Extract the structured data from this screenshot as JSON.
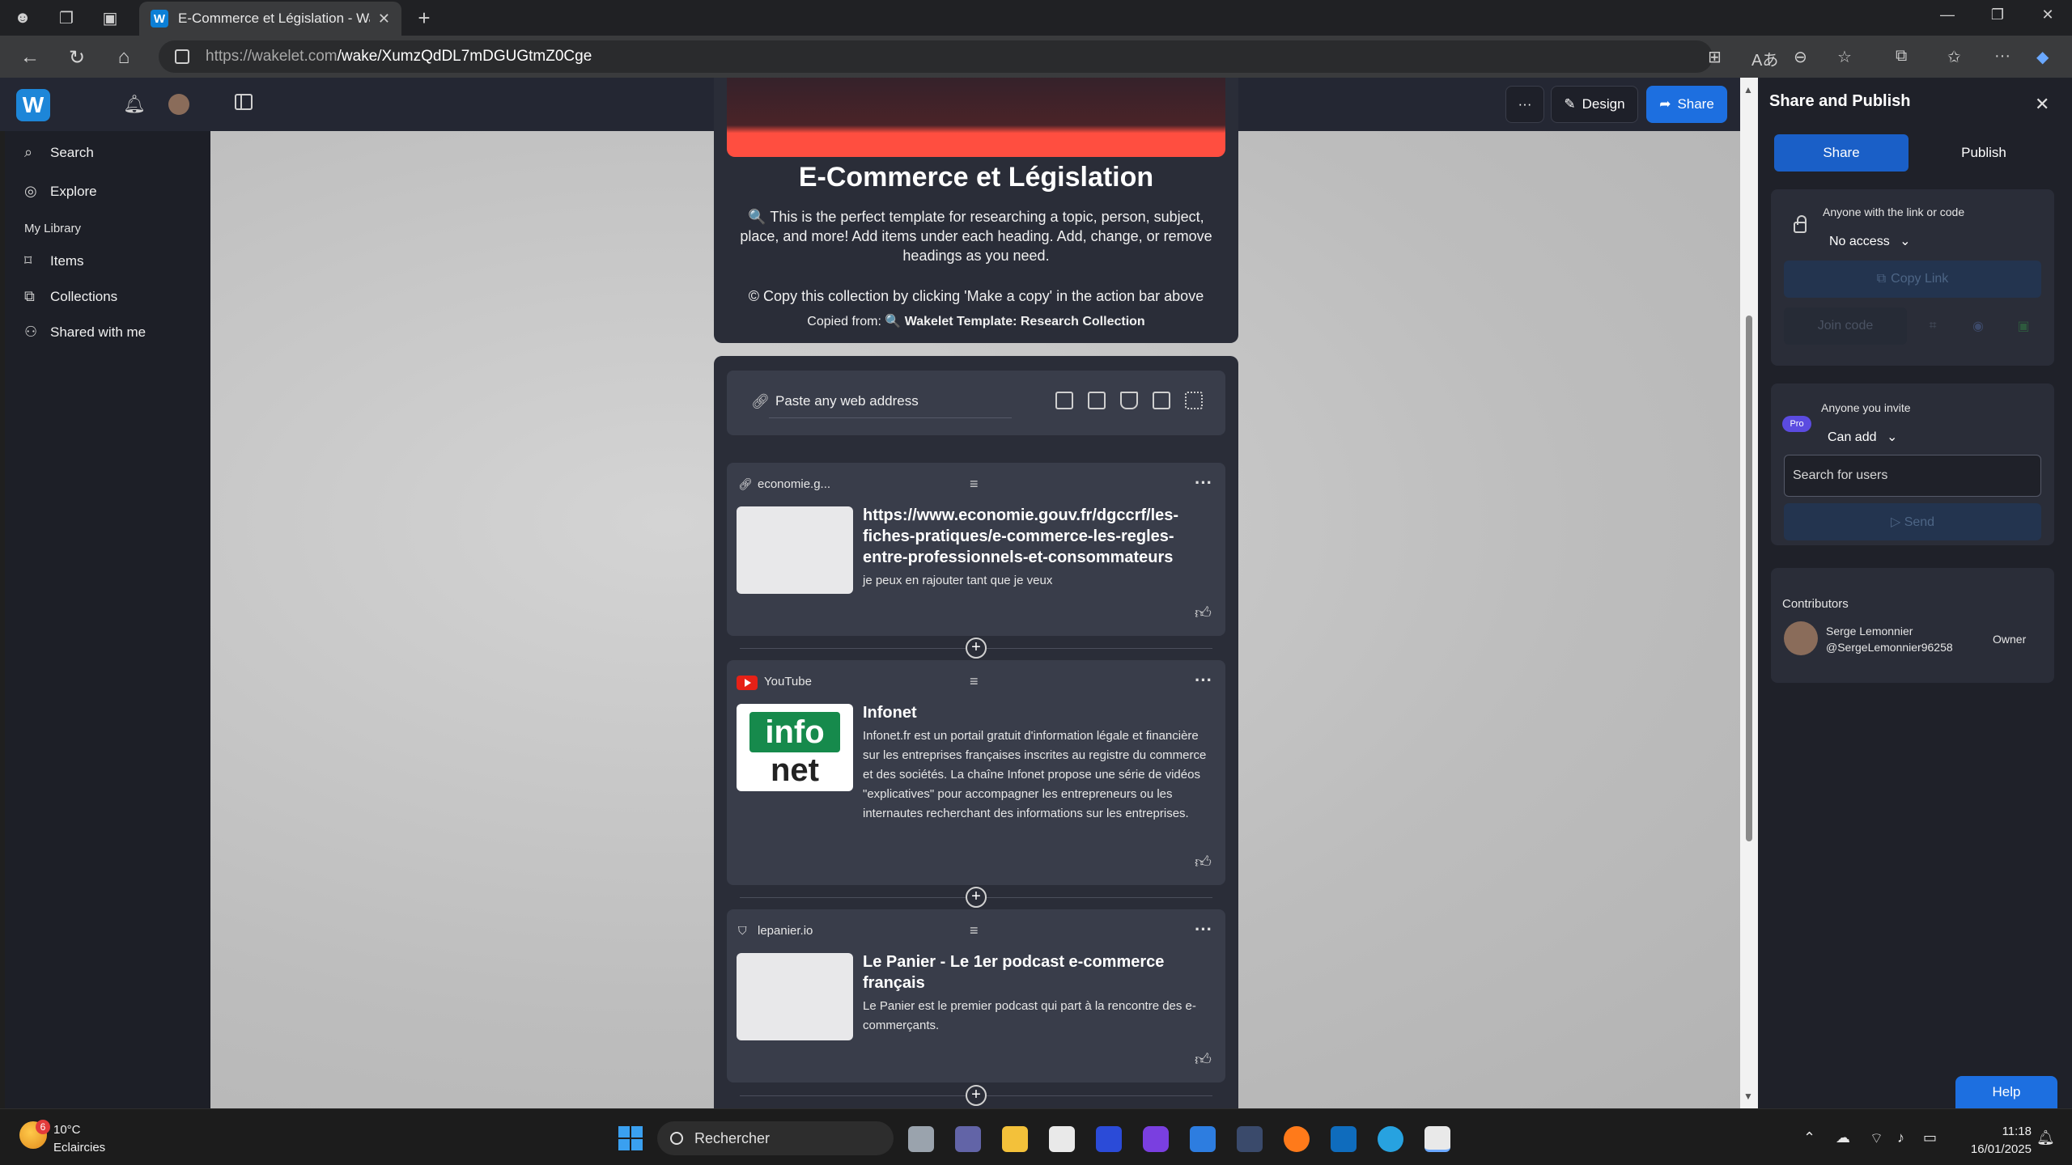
{
  "browser": {
    "tab_title": "E-Commerce et Législation - Wak",
    "tab_favicon": "W",
    "url_host": "https://wakelet.com",
    "url_path": "/wake/XumzQdDL7mDGUGtmZ0Cge"
  },
  "app": {
    "logo": "W",
    "sidebar": {
      "search": "Search",
      "explore": "Explore",
      "my_library": "My Library",
      "items": "Items",
      "collections": "Collections",
      "shared": "Shared with me"
    },
    "toolbar": {
      "more": "···",
      "design": "Design",
      "share": "Share"
    }
  },
  "collection": {
    "title": "E-Commerce et Législation",
    "description": "🔍 This is the perfect template for researching a topic, person, subject, place, and more! Add items under each heading. Add, change, or remove headings as you need.",
    "copy_note": "© Copy this collection by clicking 'Make a copy' in the action bar above",
    "copied_from_label": "Copied from:",
    "copied_from_name": "🔍 Wakelet Template: Research Collection",
    "paste_placeholder": "Paste any web address",
    "items": [
      {
        "source": "economie.g...",
        "title": "https://www.economie.gouv.fr/dgccrf/les-fiches-pratiques/e-commerce-les-regles-entre-professionnels-et-consommateurs",
        "description": "je peux en rajouter tant que je veux"
      },
      {
        "source": "YouTube",
        "thumb_top": "info",
        "thumb_bottom": "net",
        "title": "Infonet",
        "description": "Infonet.fr est un portail gratuit d'information légale et financière sur les entreprises françaises inscrites au registre du commerce et des sociétés. La chaîne Infonet propose une série de vidéos \"explicatives\" pour accompagner les entrepreneurs ou les internautes recherchant des informations sur les entreprises."
      },
      {
        "source": "lepanier.io",
        "title": "Le Panier - Le 1er podcast e-commerce français",
        "description": "Le Panier est le premier podcast qui part à la rencontre des e-commerçants."
      }
    ]
  },
  "share_panel": {
    "title": "Share and Publish",
    "tab_share": "Share",
    "tab_publish": "Publish",
    "link_label": "Anyone with the link or code",
    "link_access": "No access",
    "copy_link": "Copy Link",
    "join_code": "Join code",
    "pro": "Pro",
    "invite_label": "Anyone you invite",
    "invite_access": "Can add",
    "search_users": "Search for users",
    "send": "▷ Send",
    "contributors_label": "Contributors",
    "contributor_name": "Serge Lemonnier",
    "contributor_handle": "@SergeLemonnier96258",
    "contributor_role": "Owner",
    "help": "Help"
  },
  "taskbar": {
    "temp": "10°C",
    "weather": "Eclaircies",
    "weather_badge": "6",
    "search": "Rechercher",
    "time": "11:18",
    "date": "16/01/2025"
  },
  "colors": {
    "accent": "#1d6fe0",
    "banner": "#ff4e40",
    "card": "#393d4a"
  }
}
